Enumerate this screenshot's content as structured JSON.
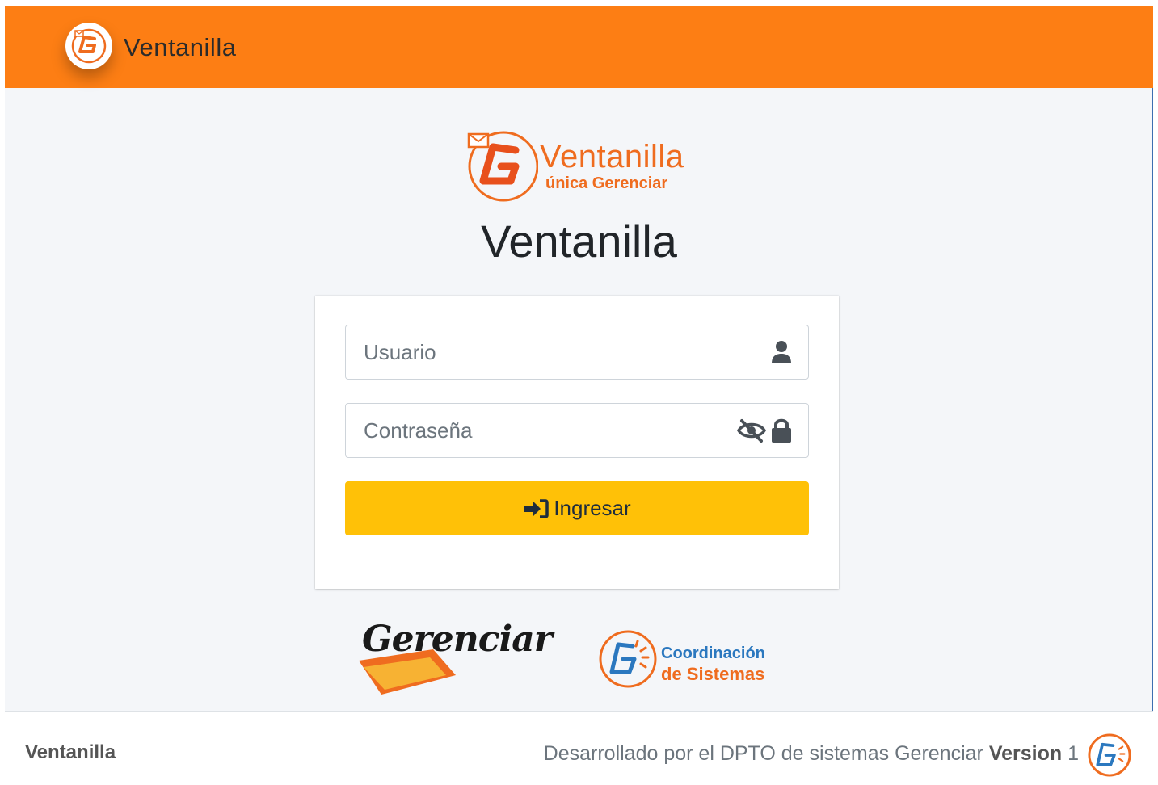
{
  "navbar": {
    "brand_text": "Ventanilla",
    "brand_logo_icon": "gerenciar-g-logo-icon"
  },
  "hero": {
    "logo_word1": "Ventanilla",
    "logo_word2": "única Gerenciar",
    "title": "Ventanilla"
  },
  "form": {
    "username_placeholder": "Usuario",
    "username_value": "",
    "password_placeholder": "Contraseña",
    "password_value": "",
    "submit_label": "Ingresar",
    "icons": [
      "user-icon",
      "eye-slash-icon",
      "lock-icon",
      "sign-in-icon"
    ]
  },
  "partners": {
    "gerenciar_text": "Gerenciar",
    "coord_line1": "Coordinación",
    "coord_line2": "de Sistemas"
  },
  "footer": {
    "left": "Ventanilla",
    "developed_by": "Desarrollado por el DPTO de sistemas Gerenciar",
    "version_label": "Version",
    "version_number": "1"
  },
  "colors": {
    "navbar": "#fd7e14",
    "accent_orange": "#ef6c1f",
    "button": "#ffc107",
    "coord_blue": "#2b78bf",
    "background": "#f4f6f9"
  }
}
